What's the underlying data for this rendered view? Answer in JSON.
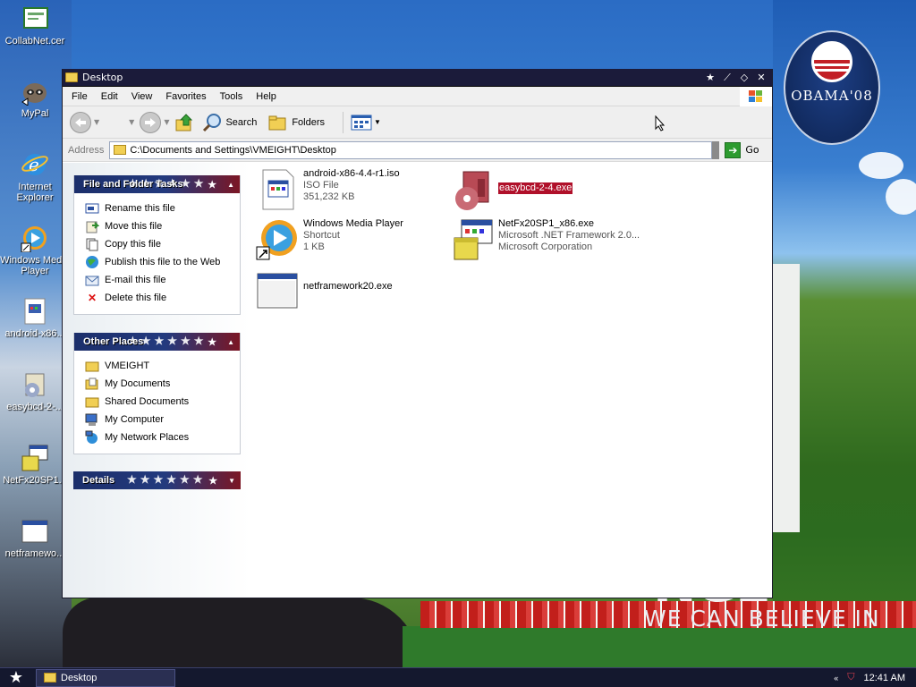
{
  "desktop": {
    "icons": [
      {
        "label": "CollabNet.cer"
      },
      {
        "label": "MyPal"
      },
      {
        "label": "Internet Explorer"
      },
      {
        "label": "Windows Media Player"
      },
      {
        "label": "android-x86..."
      },
      {
        "label": "easybcd-2-..."
      },
      {
        "label": "NetFx20SP1..."
      },
      {
        "label": "netframewo..."
      }
    ],
    "wallpaper": {
      "logo_text": "OBAMA'08",
      "slogan_big": "NGE",
      "slogan_small": "WE CAN BELIEVE IN"
    }
  },
  "window": {
    "title": "Desktop",
    "menu": [
      "File",
      "Edit",
      "View",
      "Favorites",
      "Tools",
      "Help"
    ],
    "toolbar": {
      "search_label": "Search",
      "folders_label": "Folders"
    },
    "address": {
      "label": "Address",
      "value": "C:\\Documents and Settings\\VMEIGHT\\Desktop",
      "go_label": "Go"
    },
    "task_panes": [
      {
        "title": "File and Folder Tasks",
        "items": [
          {
            "label": "Rename this file",
            "icon": "rename-icon"
          },
          {
            "label": "Move this file",
            "icon": "move-icon"
          },
          {
            "label": "Copy this file",
            "icon": "copy-icon"
          },
          {
            "label": "Publish this file to the Web",
            "icon": "globe-icon"
          },
          {
            "label": "E-mail this file",
            "icon": "email-icon"
          },
          {
            "label": "Delete this file",
            "icon": "delete-icon"
          }
        ]
      },
      {
        "title": "Other Places",
        "items": [
          {
            "label": "VMEIGHT",
            "icon": "folder-icon"
          },
          {
            "label": "My Documents",
            "icon": "my-documents-icon"
          },
          {
            "label": "Shared Documents",
            "icon": "folder-icon"
          },
          {
            "label": "My Computer",
            "icon": "computer-icon"
          },
          {
            "label": "My Network Places",
            "icon": "network-icon"
          }
        ]
      },
      {
        "title": "Details",
        "items": []
      }
    ],
    "files": [
      {
        "name": "android-x86-4.4-r1.iso",
        "line2": "ISO File",
        "line3": "351,232 KB",
        "icon": "iso-file-icon",
        "selected": false
      },
      {
        "name": "easybcd-2-4.exe",
        "line2": "",
        "line3": "",
        "icon": "easybcd-icon",
        "selected": true
      },
      {
        "name": "Windows Media Player",
        "line2": "Shortcut",
        "line3": "1 KB",
        "icon": "media-player-icon",
        "selected": false
      },
      {
        "name": "NetFx20SP1_x86.exe",
        "line2": "Microsoft .NET Framework 2.0...",
        "line3": "Microsoft Corporation",
        "icon": "installer-icon",
        "selected": false
      },
      {
        "name": "netframework20.exe",
        "line2": "",
        "line3": "",
        "icon": "exe-window-icon",
        "selected": false
      }
    ]
  },
  "taskbar": {
    "active_window": "Desktop",
    "clock": "12:41 AM"
  },
  "colors": {
    "titlebar": "#1b1b3a",
    "pane_header_left": "#1c2f6b",
    "pane_header_right": "#7b1624",
    "selection": "#b0102a",
    "taskbar": "#14182e"
  }
}
